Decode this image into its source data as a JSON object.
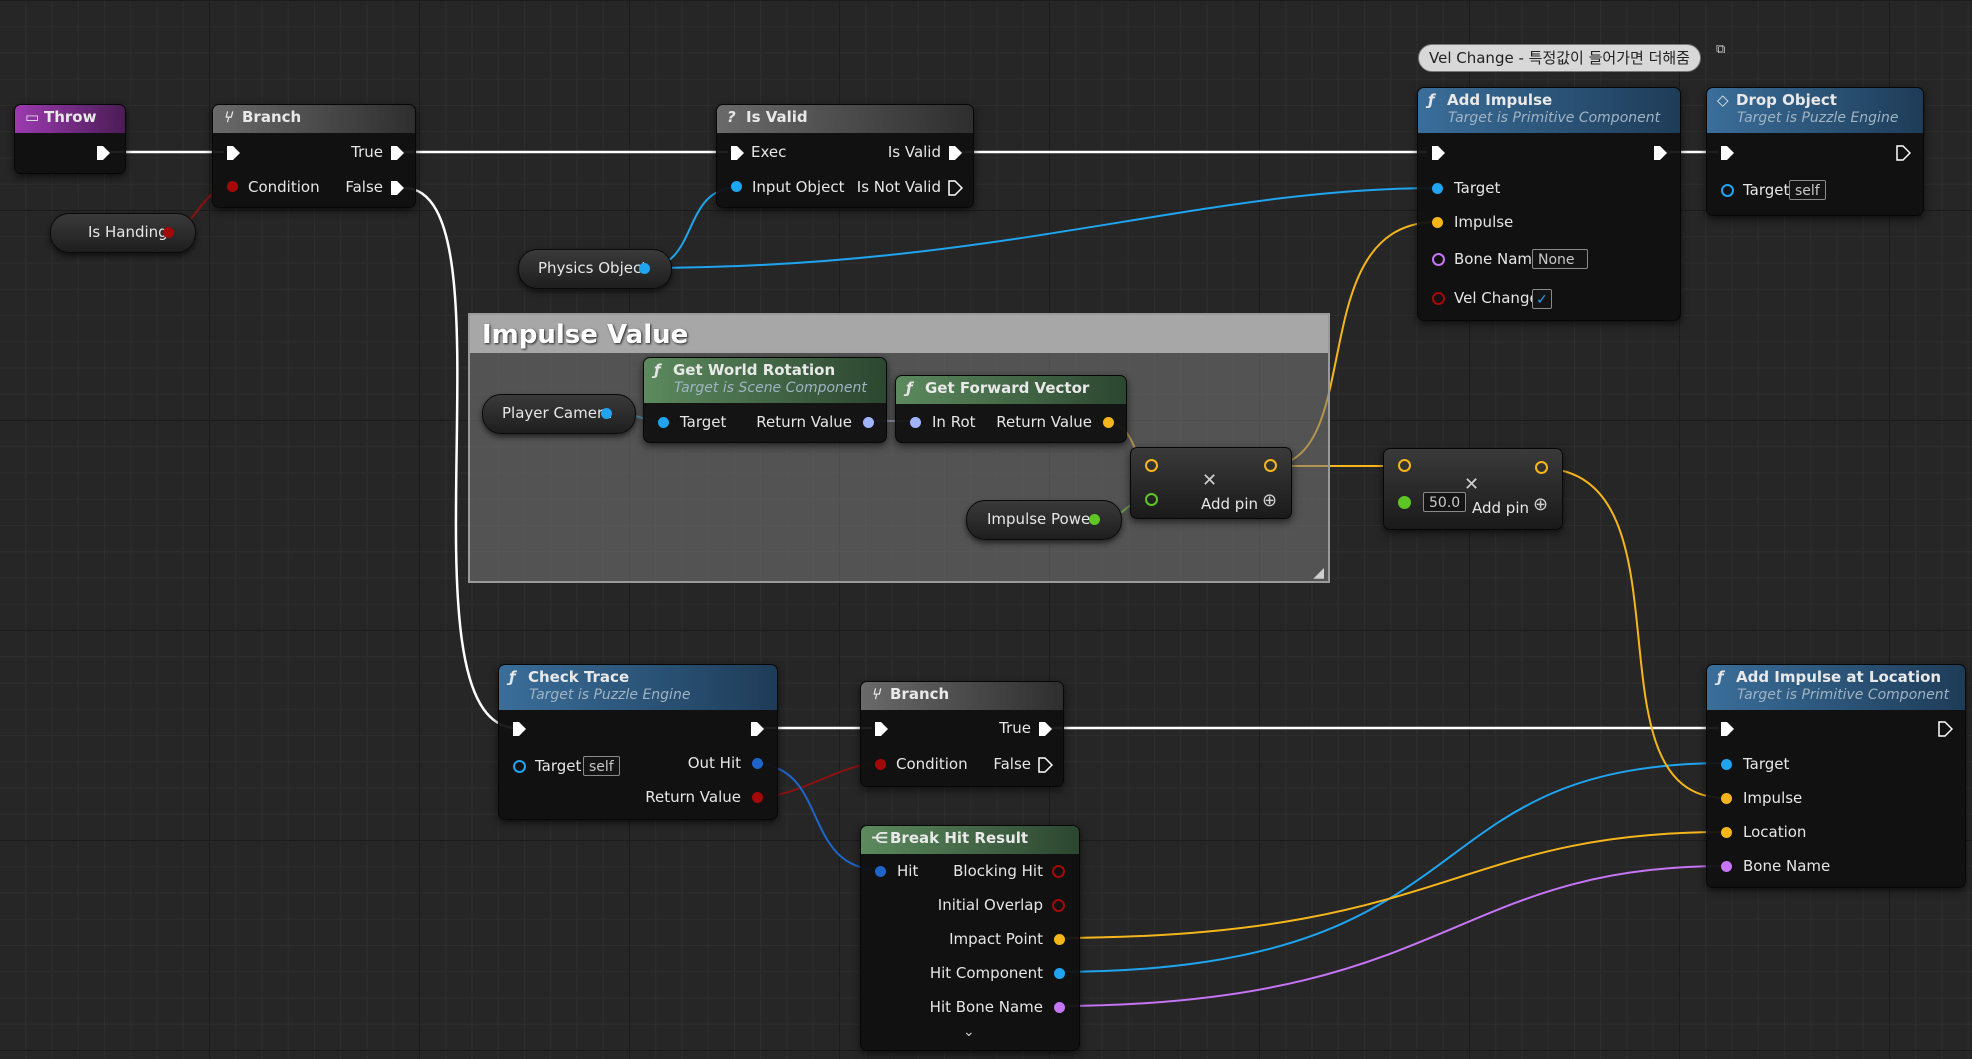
{
  "colors": {
    "exec": "#ffffff",
    "object": "#1fa4f0",
    "vector": "#f5b61c",
    "boolean": "#a30909",
    "name": "#c575f5",
    "float": "#5ec526",
    "rotator": "#a0b4ff",
    "func_header": "#2d4a66",
    "pure_header": "#46684a",
    "event_header": "#7a2b8f",
    "macro_header": "#5a5a5a"
  },
  "comment": {
    "title": "Impulse Value"
  },
  "bubble": {
    "text": "Vel Change - 특정값이 들어가면 더해줌"
  },
  "nodes": {
    "throw": {
      "title": "Throw"
    },
    "branch1": {
      "title": "Branch",
      "true_label": "True",
      "false_label": "False",
      "condition_label": "Condition"
    },
    "is_handing": {
      "label": "Is Handing"
    },
    "is_valid": {
      "title": "Is Valid",
      "exec_label": "Exec",
      "input_label": "Input Object",
      "valid_label": "Is Valid",
      "not_valid_label": "Is Not Valid"
    },
    "physics_object": {
      "label": "Physics Object"
    },
    "add_impulse": {
      "title": "Add Impulse",
      "subtitle": "Target is Primitive Component",
      "target": "Target",
      "impulse": "Impulse",
      "bone_name": "Bone Name",
      "bone_value": "None",
      "vel_change": "Vel Change",
      "vel_checked": "✓"
    },
    "drop_object": {
      "title": "Drop Object",
      "subtitle": "Target is Puzzle Engine",
      "target": "Target",
      "target_value": "self"
    },
    "player_camera": {
      "label": "Player Camera"
    },
    "get_world_rotation": {
      "title": "Get World Rotation",
      "subtitle": "Target is Scene Component",
      "target": "Target",
      "return": "Return Value"
    },
    "get_forward_vector": {
      "title": "Get Forward Vector",
      "in_rot": "In Rot",
      "return": "Return Value"
    },
    "impulse_power": {
      "label": "Impulse Power"
    },
    "multiply": {
      "add_pin": "Add pin"
    },
    "multiply2": {
      "value": "50.0",
      "add_pin": "Add pin"
    },
    "check_trace": {
      "title": "Check Trace",
      "subtitle": "Target is Puzzle Engine",
      "target": "Target",
      "target_value": "self",
      "out_hit": "Out Hit",
      "return": "Return Value"
    },
    "branch2": {
      "title": "Branch",
      "true_label": "True",
      "false_label": "False",
      "condition_label": "Condition"
    },
    "break_hit": {
      "title": "Break Hit Result",
      "hit": "Hit",
      "blocking_hit": "Blocking Hit",
      "initial_overlap": "Initial Overlap",
      "impact_point": "Impact Point",
      "hit_component": "Hit Component",
      "hit_bone_name": "Hit Bone Name"
    },
    "add_impulse_loc": {
      "title": "Add Impulse at Location",
      "subtitle": "Target is Primitive Component",
      "target": "Target",
      "impulse": "Impulse",
      "location": "Location",
      "bone_name": "Bone Name"
    }
  },
  "icons": {
    "function": "function-icon",
    "branch": "branch-icon",
    "question": "question-mark-icon",
    "event": "event-icon",
    "macro": "macro-icon",
    "break": "break-struct-icon",
    "multiply": "multiply-icon",
    "add": "add-pin-icon",
    "chevron": "chevron-down-icon"
  }
}
